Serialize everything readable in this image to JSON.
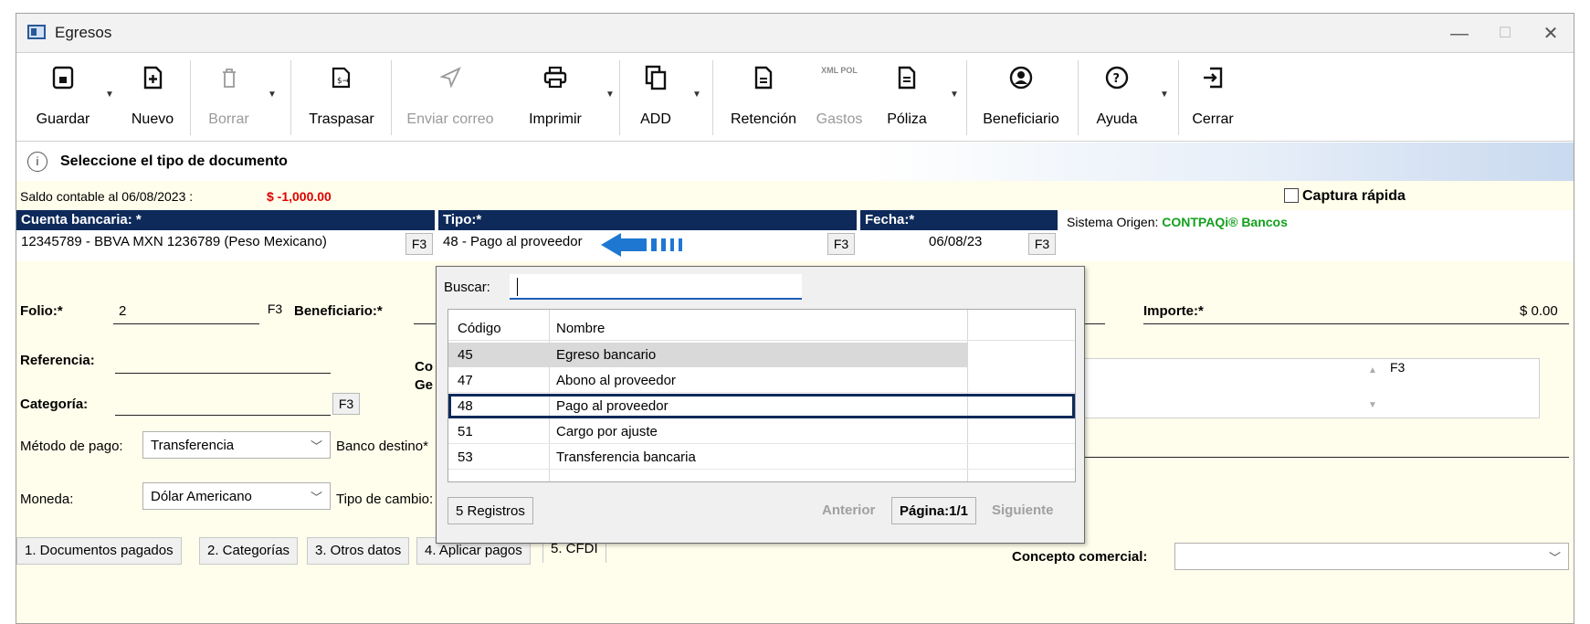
{
  "window": {
    "title": "Egresos"
  },
  "toolbar": {
    "guardar": "Guardar",
    "nuevo": "Nuevo",
    "borrar": "Borrar",
    "traspasar": "Traspasar",
    "enviar_correo": "Enviar correo",
    "imprimir": "Imprimir",
    "add": "ADD",
    "retencion": "Retención",
    "gastos": "Gastos",
    "xml_pol": "XML POL",
    "poliza": "Póliza",
    "beneficiario": "Beneficiario",
    "ayuda": "Ayuda",
    "cerrar": "Cerrar"
  },
  "message": "Seleccione el tipo de documento",
  "saldo": {
    "label": "Saldo contable al 06/08/2023 :",
    "value": "$ -1,000.00",
    "value_color": "#e00000"
  },
  "captura_rapida": "Captura rápida",
  "cuenta": {
    "header": "Cuenta bancaria: *",
    "value": "12345789 - BBVA MXN 1236789 (Peso Mexicano)"
  },
  "tipo": {
    "header": "Tipo:*",
    "value": "48 - Pago al proveedor"
  },
  "fecha": {
    "header": "Fecha:*",
    "value": "06/08/23"
  },
  "sistema": {
    "label": "Sistema Origen:",
    "value": "CONTPAQi® Bancos",
    "value_color": "#14a01e"
  },
  "f3": "F3",
  "folio": {
    "label": "Folio:*",
    "value": "2"
  },
  "beneficiario_label": "Beneficiario:*",
  "importe": {
    "label": "Importe:*",
    "value": "$ 0.00"
  },
  "referencia_label": "Referencia:",
  "concepto_partial_1": "Co",
  "concepto_partial_2": "Ge",
  "categoria_label": "Categoría:",
  "metodo": {
    "label": "Método de pago:",
    "value": "Transferencia"
  },
  "banco_destino_label": "Banco destino*",
  "moneda": {
    "label": "Moneda:",
    "value": "Dólar Americano"
  },
  "tipo_cambio_label": "Tipo de cambio:",
  "concepto_comercial_label": "Concepto comercial:",
  "tabs": [
    "1. Documentos pagados",
    "2. Categorías",
    "3. Otros datos",
    "4. Aplicar pagos",
    "5. CFDI"
  ],
  "popup": {
    "buscar_label": "Buscar:",
    "buscar_value": "",
    "col_codigo": "Código",
    "col_nombre": "Nombre",
    "rows": [
      {
        "codigo": "45",
        "nombre": "Egreso bancario"
      },
      {
        "codigo": "47",
        "nombre": "Abono al proveedor"
      },
      {
        "codigo": "48",
        "nombre": "Pago al proveedor"
      },
      {
        "codigo": "51",
        "nombre": "Cargo por ajuste"
      },
      {
        "codigo": "53",
        "nombre": "Transferencia bancaria"
      }
    ],
    "registros": "5 Registros",
    "anterior": "Anterior",
    "pagina": "Página:1/1",
    "siguiente": "Siguiente"
  },
  "colors": {
    "header_bg": "#0e2a5a",
    "form_bg": "#fffdeb",
    "arrow": "#1e78d2"
  }
}
